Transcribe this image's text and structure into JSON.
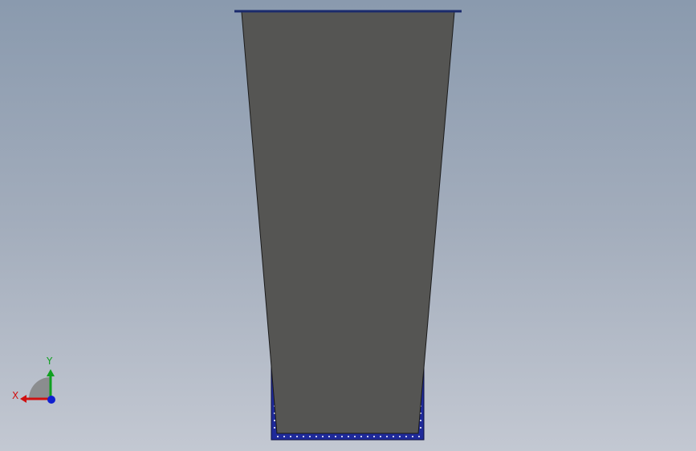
{
  "viewport": {
    "background_top": "#8a9aae",
    "background_bottom": "#c3c8d2"
  },
  "model": {
    "body_color": "#555553",
    "edge_color": "#1a1a1a",
    "rim_color": "#1a2a6c",
    "base_color": "#1f2a9a",
    "dot_color": "#ffffff"
  },
  "triad": {
    "x_label": "X",
    "y_label": "Y",
    "x_color": "#d01010",
    "y_color": "#10a020",
    "z_color": "#1020d0"
  }
}
